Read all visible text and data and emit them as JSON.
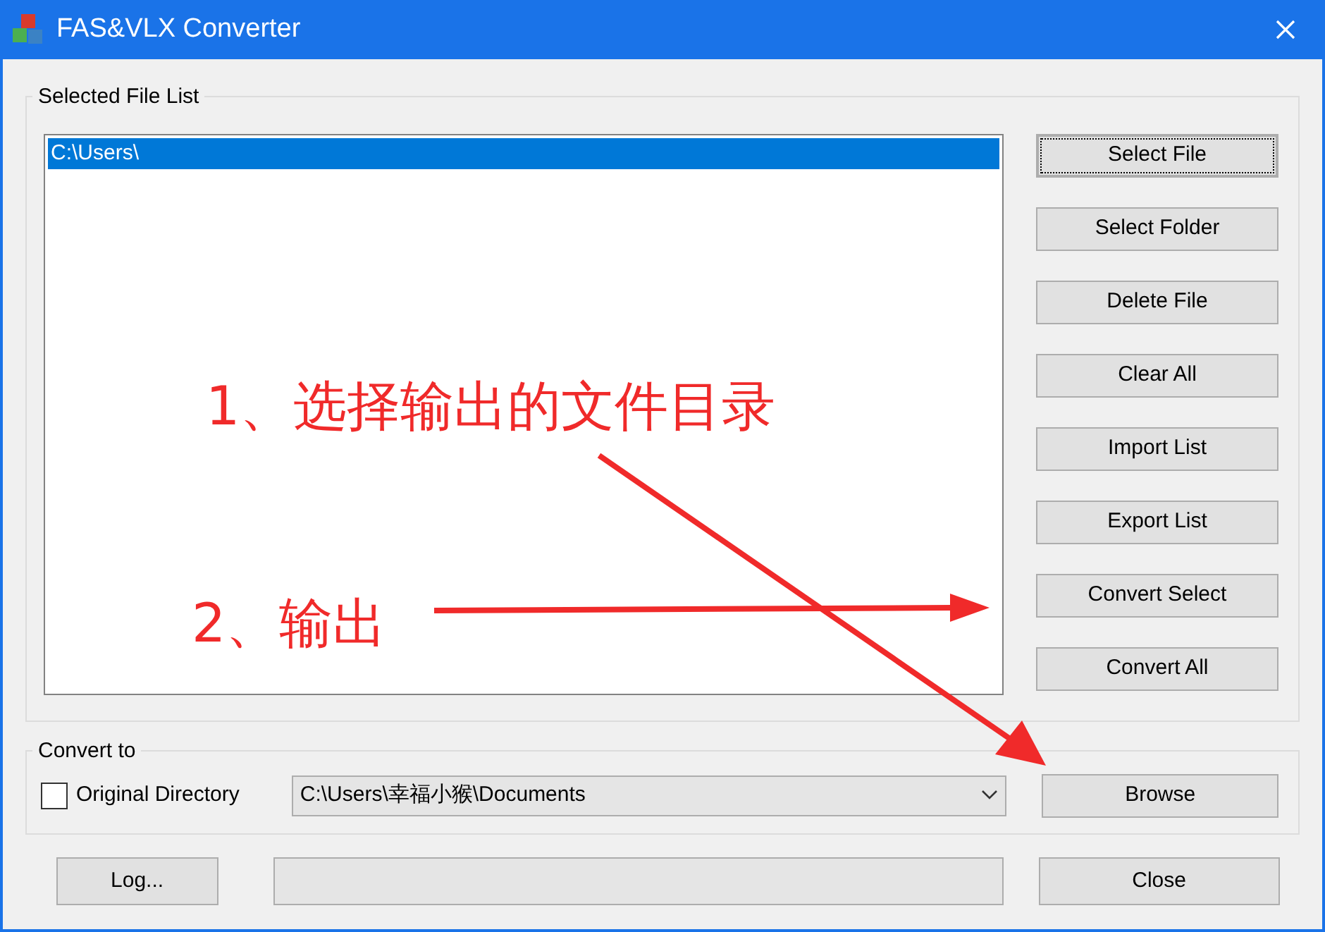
{
  "window": {
    "title": "FAS&VLX Converter"
  },
  "file_list": {
    "label": "Selected File List",
    "items": [
      {
        "text": "C:\\Users\\",
        "selected": true
      }
    ]
  },
  "side_buttons": [
    {
      "label": "Select File",
      "focused": true
    },
    {
      "label": "Select Folder",
      "focused": false
    },
    {
      "label": "Delete File",
      "focused": false
    },
    {
      "label": "Clear All",
      "focused": false
    },
    {
      "label": "Import List",
      "focused": false
    },
    {
      "label": "Export List",
      "focused": false
    },
    {
      "label": "Convert Select",
      "focused": false
    },
    {
      "label": "Convert All",
      "focused": false
    }
  ],
  "convert_to": {
    "label": "Convert to",
    "checkbox": {
      "label": "Original Directory",
      "checked": false
    },
    "directory": {
      "value": "C:\\Users\\幸福小猴\\Documents"
    },
    "browse": "Browse"
  },
  "bottom": {
    "log": "Log...",
    "close": "Close"
  },
  "annotations": [
    {
      "text": "1、选择输出的文件目录"
    },
    {
      "text": "2、输出"
    }
  ]
}
